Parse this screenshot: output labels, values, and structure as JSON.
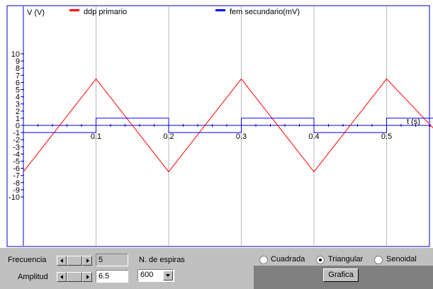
{
  "chart_data": {
    "type": "line",
    "ylabel": "V (V)",
    "xlabel": "t (s)",
    "ylim": [
      -11,
      11
    ],
    "xlim": [
      0,
      0.57
    ],
    "y_ticks": [
      "10",
      "9",
      "8",
      "7",
      "6",
      "5",
      "4",
      "3",
      "2",
      "1",
      "0",
      "-1",
      "-2",
      "-3",
      "-4",
      "-5",
      "-6",
      "-7",
      "-8",
      "-9",
      "-10"
    ],
    "x_ticks": [
      "0.1",
      "0.2",
      "0.3",
      "0.4",
      "0.5"
    ],
    "grid": true,
    "legend_placement": "top",
    "series": [
      {
        "name": "ddp primario",
        "color": "#ff0000",
        "x": [
          0,
          0.1,
          0.2,
          0.3,
          0.4,
          0.5,
          0.57
        ],
        "y": [
          -6.5,
          6.5,
          -6.5,
          6.5,
          -6.5,
          6.5,
          -1.0
        ]
      },
      {
        "name": "fem secundario(mV)",
        "color": "#0000ff",
        "x": [
          0,
          0.1,
          0.1,
          0.2,
          0.2,
          0.3,
          0.3,
          0.4,
          0.4,
          0.5,
          0.5,
          0.57
        ],
        "y": [
          -1,
          -1,
          1,
          1,
          -1,
          -1,
          1,
          1,
          -1,
          -1,
          1,
          1
        ]
      }
    ]
  },
  "controls": {
    "frecuencia_label": "Frecuencia",
    "frecuencia_value": "5",
    "amplitud_label": "Amplitud",
    "amplitud_value": "6.5",
    "espiras_label": "N. de espiras",
    "espiras_value": "600",
    "wave_options": [
      "Cuadrada",
      "Triangular",
      "Senoidal"
    ],
    "wave_selected": "Triangular",
    "grafica_label": "Grafica"
  }
}
